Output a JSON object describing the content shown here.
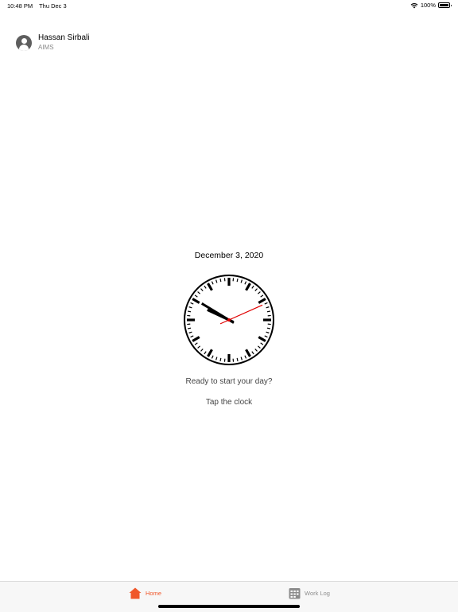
{
  "status_bar": {
    "time": "10:48 PM",
    "date": "Thu Dec 3",
    "battery": "100%",
    "battery_level": 1.0
  },
  "user": {
    "name": "Hassan Sirbali",
    "organization": "AIMS"
  },
  "main": {
    "date": "December 3, 2020",
    "clock": {
      "hours": 9,
      "minutes": 50,
      "seconds": 11
    },
    "prompt": "Ready to start your day?",
    "action": "Tap the clock"
  },
  "tabs": [
    {
      "label": "Home",
      "icon": "home-icon",
      "active": true
    },
    {
      "label": "Work Log",
      "icon": "worklog-icon",
      "active": false
    }
  ],
  "colors": {
    "accent": "#f0572a",
    "second_hand": "#e00000",
    "inactive": "#8c8c8c"
  }
}
